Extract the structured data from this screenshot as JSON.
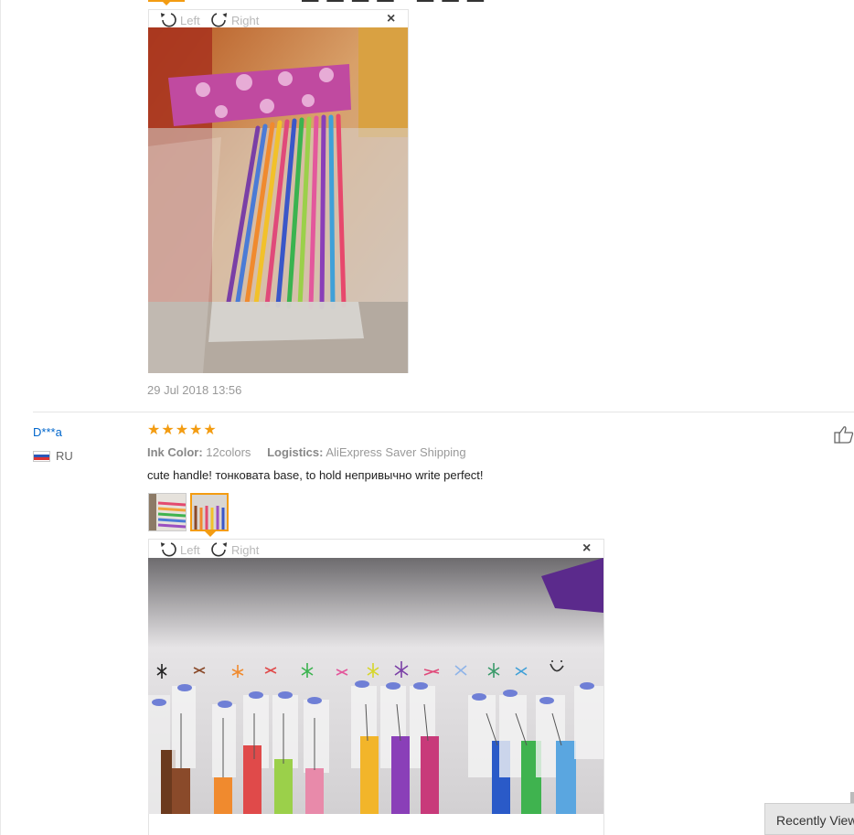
{
  "top_viewer": {
    "rotate_left_label": "Left",
    "rotate_right_label": "Right",
    "close_label": "×",
    "date": "29 Jul 2018 13:56"
  },
  "review": {
    "reviewer_name": "D***a",
    "country_code": "RU",
    "rating": 5,
    "stars": [
      "★",
      "★",
      "★",
      "★",
      "★"
    ],
    "attributes": [
      {
        "label": "Ink Color:",
        "value": "12colors"
      },
      {
        "label": "Logistics:",
        "value": "AliExpress Saver Shipping"
      }
    ],
    "text": "cute handle! тонковата base, to hold непривычно write perfect!",
    "photos_count": 2,
    "selected_photo": 2
  },
  "bottom_viewer": {
    "rotate_left_label": "Left",
    "rotate_right_label": "Right",
    "close_label": "×"
  },
  "recently_viewed": {
    "label": "Recently Viewed"
  },
  "icons": {
    "rotate_left": "rotate-left-icon",
    "rotate_right": "rotate-right-icon",
    "close": "close-icon",
    "star": "star-icon",
    "flag": "russia-flag-icon",
    "like": "thumbs-up-icon"
  },
  "colors": {
    "accent": "#f39c12",
    "link": "#0066cc",
    "muted": "#999999"
  }
}
